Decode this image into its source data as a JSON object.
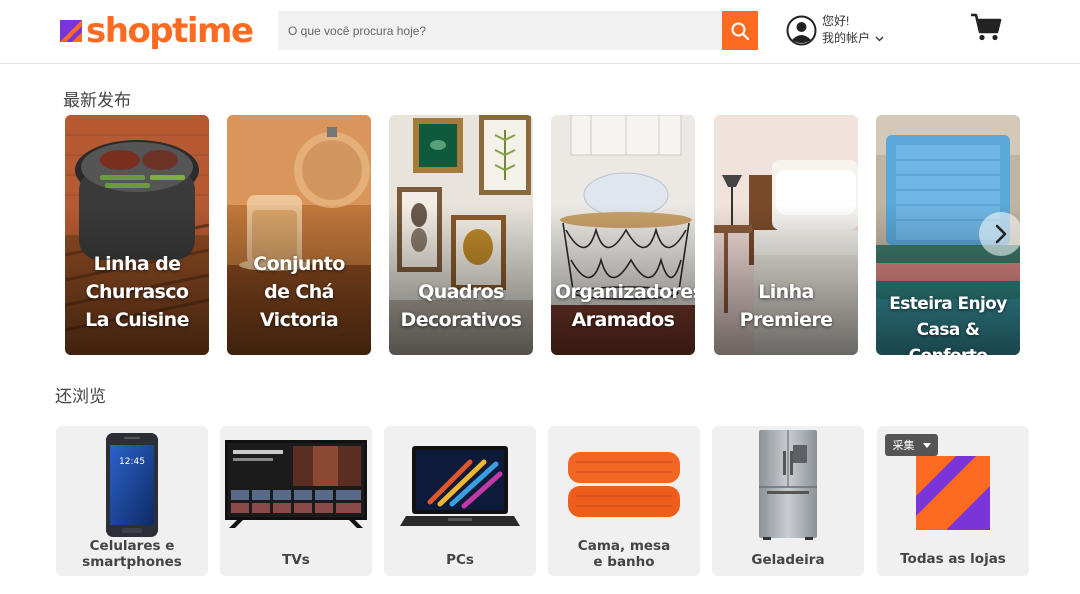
{
  "brand": {
    "name": "shoptime",
    "accent_color": "#fc6b21",
    "secondary_color": "#7a35d8"
  },
  "search": {
    "placeholder": "O que você procura hoje?",
    "icon": "search-icon"
  },
  "account": {
    "greeting": "您好!",
    "link_label": "我的帐户",
    "icon": "user-circle-icon"
  },
  "cart": {
    "icon": "cart-icon"
  },
  "latest": {
    "title": "最新发布",
    "next_icon": "chevron-right-icon",
    "items": [
      {
        "label": "Linha de\nChurrasco\nLa Cuisine"
      },
      {
        "label": "Conjunto\nde Chá\nVictoria"
      },
      {
        "label": "Quadros\nDecorativos"
      },
      {
        "label": "Organizadores\nAramados"
      },
      {
        "label": "Linha\nPremiere"
      },
      {
        "label": "Esteira Enjoy\nCasa & Conforto"
      }
    ]
  },
  "browse": {
    "title": "还浏览",
    "collect_label": "采集",
    "items": [
      {
        "label": "Celulares e\nsmartphones"
      },
      {
        "label": "TVs"
      },
      {
        "label": "PCs"
      },
      {
        "label": "Cama, mesa\ne banho"
      },
      {
        "label": "Geladeira"
      },
      {
        "label": "Todas as lojas"
      }
    ]
  }
}
